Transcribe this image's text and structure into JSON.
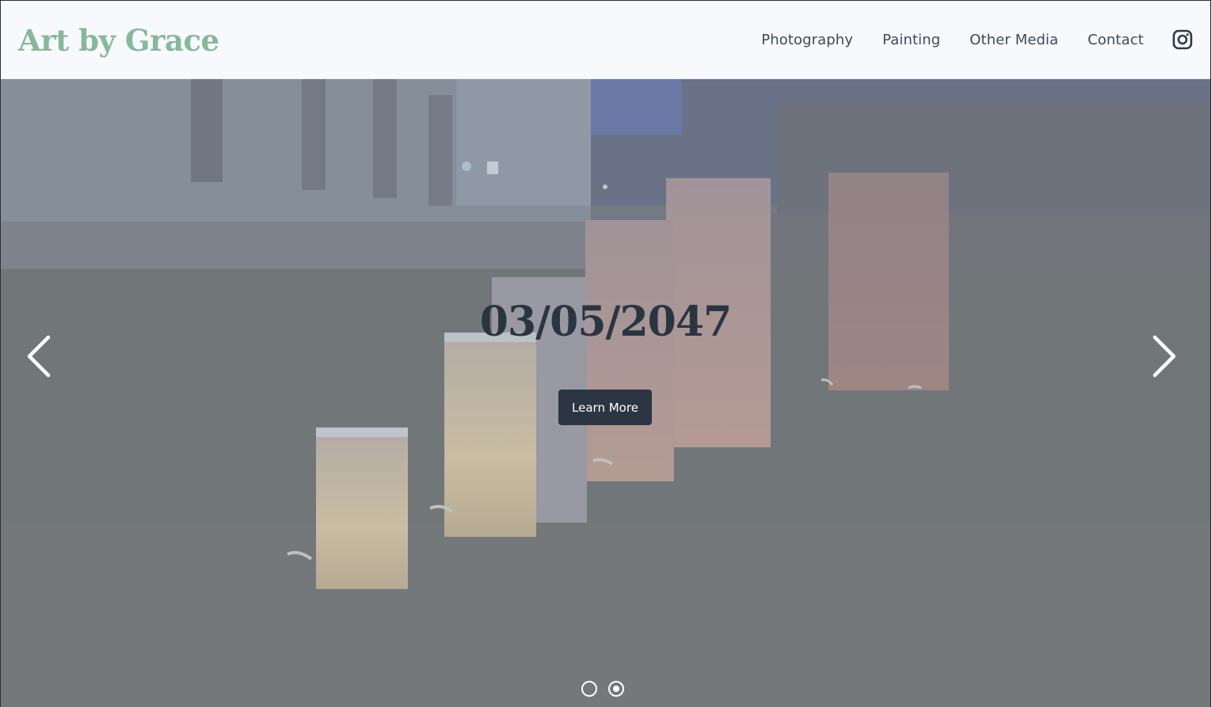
{
  "header": {
    "logo": "Art by Grace",
    "nav": [
      "Photography",
      "Painting",
      "Other Media",
      "Contact"
    ],
    "social_icon": "instagram-icon"
  },
  "hero": {
    "title": "03/05/2047",
    "cta_label": "Learn More",
    "prev_icon": "chevron-left-icon",
    "next_icon": "chevron-right-icon",
    "slides_count": 2,
    "active_slide": 2
  },
  "colors": {
    "logo": "#86b89a",
    "nav_text": "#3f4a57",
    "cta_bg": "#2c3643",
    "title": "#2a3542"
  }
}
